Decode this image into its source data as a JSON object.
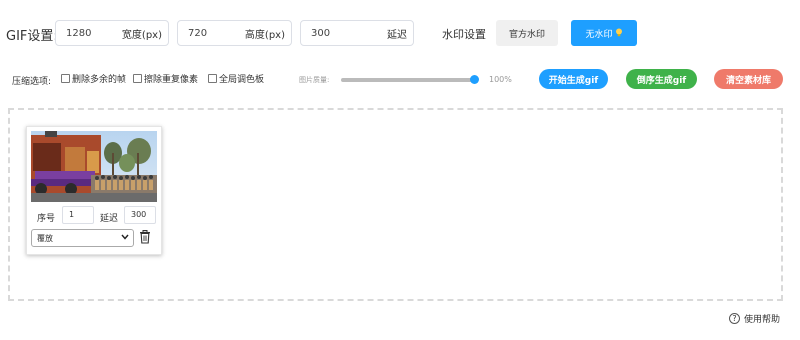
{
  "gif_settings": {
    "label": "GIF设置:",
    "width": {
      "value": "1280",
      "unit": "宽度(px)"
    },
    "height": {
      "value": "720",
      "unit": "高度(px)"
    },
    "delay": {
      "value": "300",
      "unit": "延迟"
    }
  },
  "watermark": {
    "label": "水印设置",
    "official_label": "官方水印",
    "none_label": "无水印",
    "none_icon": "bulb-icon"
  },
  "compression": {
    "label": "压缩选项:",
    "options": [
      {
        "label": "删除多余的帧",
        "checked": false
      },
      {
        "label": "擦除重复像素",
        "checked": false
      },
      {
        "label": "全局调色板",
        "checked": false
      }
    ],
    "quality_label": "图片质量:",
    "quality_value": "100%",
    "quality_level": 1.0
  },
  "actions": {
    "start": "开始生成gif",
    "reverse": "倒序生成gif",
    "clear": "清空素材库"
  },
  "frames": [
    {
      "seq_label": "序号",
      "seq_value": "1",
      "delay_label": "延迟",
      "delay_value": "300",
      "mode": "覆放"
    }
  ],
  "help": {
    "label": "使用帮助",
    "icon": "question-circle-icon"
  },
  "colors": {
    "primary": "#1e9fff",
    "green": "#3fb24a",
    "red": "#ef7a6a"
  }
}
